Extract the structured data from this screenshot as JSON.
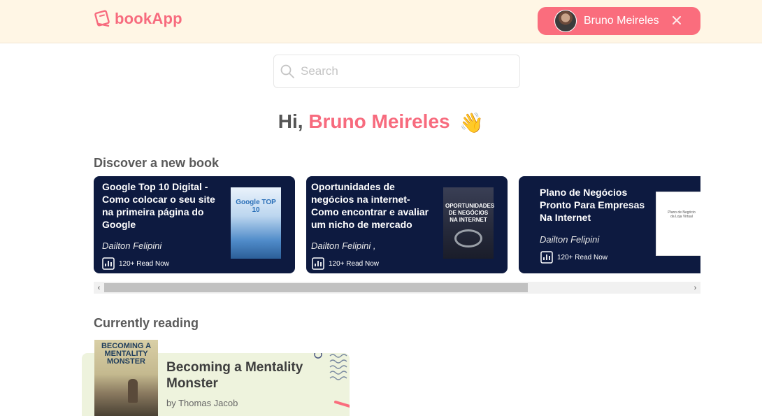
{
  "app": {
    "name": "bookApp",
    "brand_color": "#f76b7e",
    "header_bg": "#fff6e5"
  },
  "user": {
    "name": "Bruno Meireles"
  },
  "search": {
    "placeholder": "Search"
  },
  "greeting": {
    "prefix": "Hi,",
    "name": "Bruno Meireles",
    "emoji": "👋"
  },
  "discover": {
    "title": "Discover a new book",
    "books": [
      {
        "title": "Google Top 10 Digital - Como colocar o seu site na primeira página do Google",
        "author": "Dailton Felipini",
        "reads": "120+ Read Now",
        "cover_text": "Google TOP 10"
      },
      {
        "title": "Oportunidades de negócios na internet- Como encontrar e avaliar um nicho de mercado",
        "author": "Dailton Felipini ,",
        "reads": "120+ Read Now",
        "cover_text": "OPORTUNIDADES DE NEGÓCIOS NA INTERNET"
      },
      {
        "title": "Plano de Negócios Pronto Para Empresas Na Internet",
        "author": "Dailton Felipini",
        "reads": "120+ Read Now",
        "cover_text": "Plano de Negócio da Loja Virtual"
      }
    ]
  },
  "reading": {
    "title": "Currently reading",
    "book": {
      "title": "Becoming a Mentality Monster",
      "author": "by Thomas Jacob",
      "cover_text": "BECOMING A MENTALITY MONSTER"
    }
  }
}
